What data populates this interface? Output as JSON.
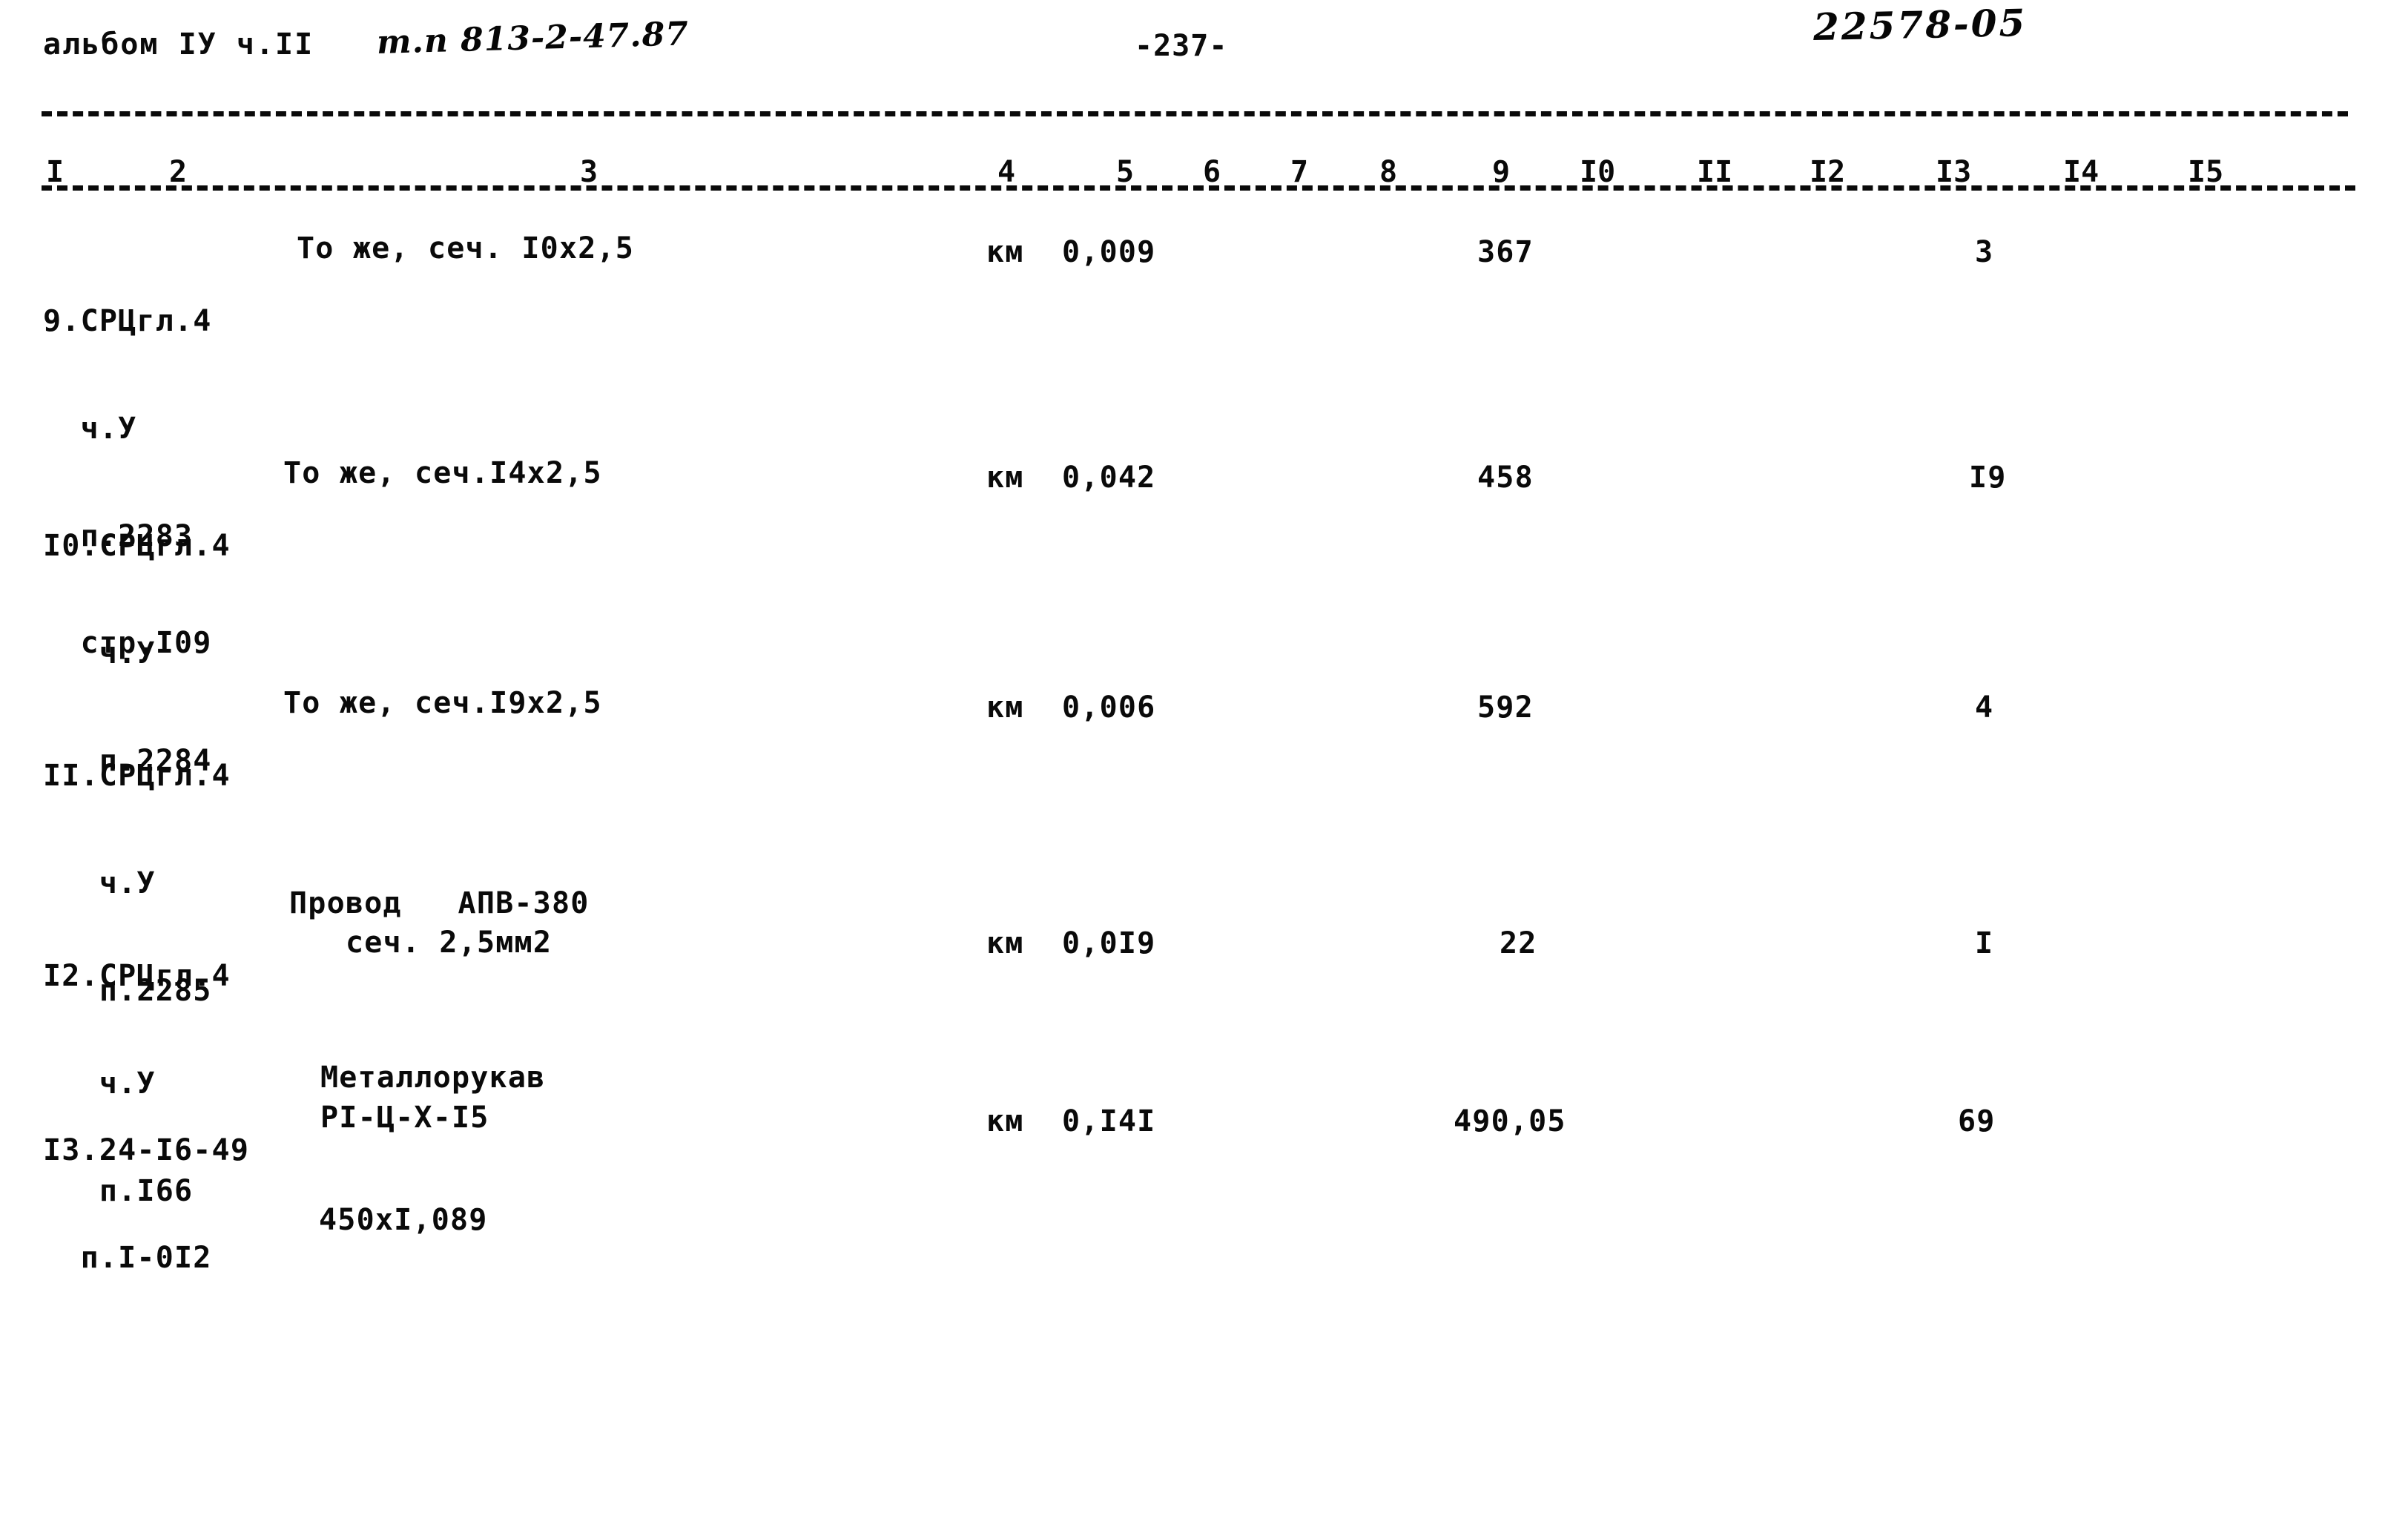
{
  "document": {
    "header_left_printed": "альбом IУ ч.II",
    "header_left_handwritten": "т.п 813-2-47.87",
    "page_number": "-237-",
    "stamp_handwritten": "22578-05"
  },
  "table": {
    "column_headers": [
      "I",
      "2",
      "3",
      "4",
      "5",
      "6",
      "7",
      "8",
      "9",
      "I0",
      "II",
      "I2",
      "I3",
      "I4",
      "I5"
    ],
    "rows": [
      {
        "id": "row-9",
        "col1_lines": [
          "9.СРЦгл.4",
          "  ч.У",
          "  п.2283",
          "  стр.I09"
        ],
        "col3": "То же, сеч. I0х2,5",
        "col4_unit": "км",
        "col5_quantity": "0,009",
        "col9_price": "367",
        "col13_total": "3"
      },
      {
        "id": "row-10",
        "col1_lines": [
          "I0.СРЦгл.4",
          "   ч.У",
          "   п.2284"
        ],
        "col3": "То же, сеч.I4х2,5",
        "col4_unit": "км",
        "col5_quantity": "0,042",
        "col9_price": "458",
        "col13_total": "I9"
      },
      {
        "id": "row-11",
        "col1_lines": [
          "II.СРЦгл.4",
          "   ч.У",
          "   п.2285"
        ],
        "col3": "То же, сеч.I9х2,5",
        "col4_unit": "км",
        "col5_quantity": "0,006",
        "col9_price": "592",
        "col13_total": "4"
      },
      {
        "id": "row-12",
        "col1_lines": [
          "I2.СРЦгл.4",
          "   ч.У",
          "   п.I66"
        ],
        "col3_line1": "Провод   АПВ-380",
        "col3_line2": "сеч. 2,5мм2",
        "col4_unit": "км",
        "col5_quantity": "0,0I9",
        "col9_price": "22",
        "col13_total": "I"
      },
      {
        "id": "row-13",
        "col1_lines": [
          "I3.24-I6-49",
          "  п.I-0I2"
        ],
        "col3_line1": "Металлорукав",
        "col3_line2": "РI-Ц-Х-I5",
        "col4_unit": "км",
        "col5_quantity": "0,I4I",
        "col9_price": "490,05",
        "col13_total": "69"
      }
    ],
    "footer_note": "450хI,089"
  },
  "colors": {
    "ink": "#0a0a0a",
    "paper": "#ffffff"
  }
}
